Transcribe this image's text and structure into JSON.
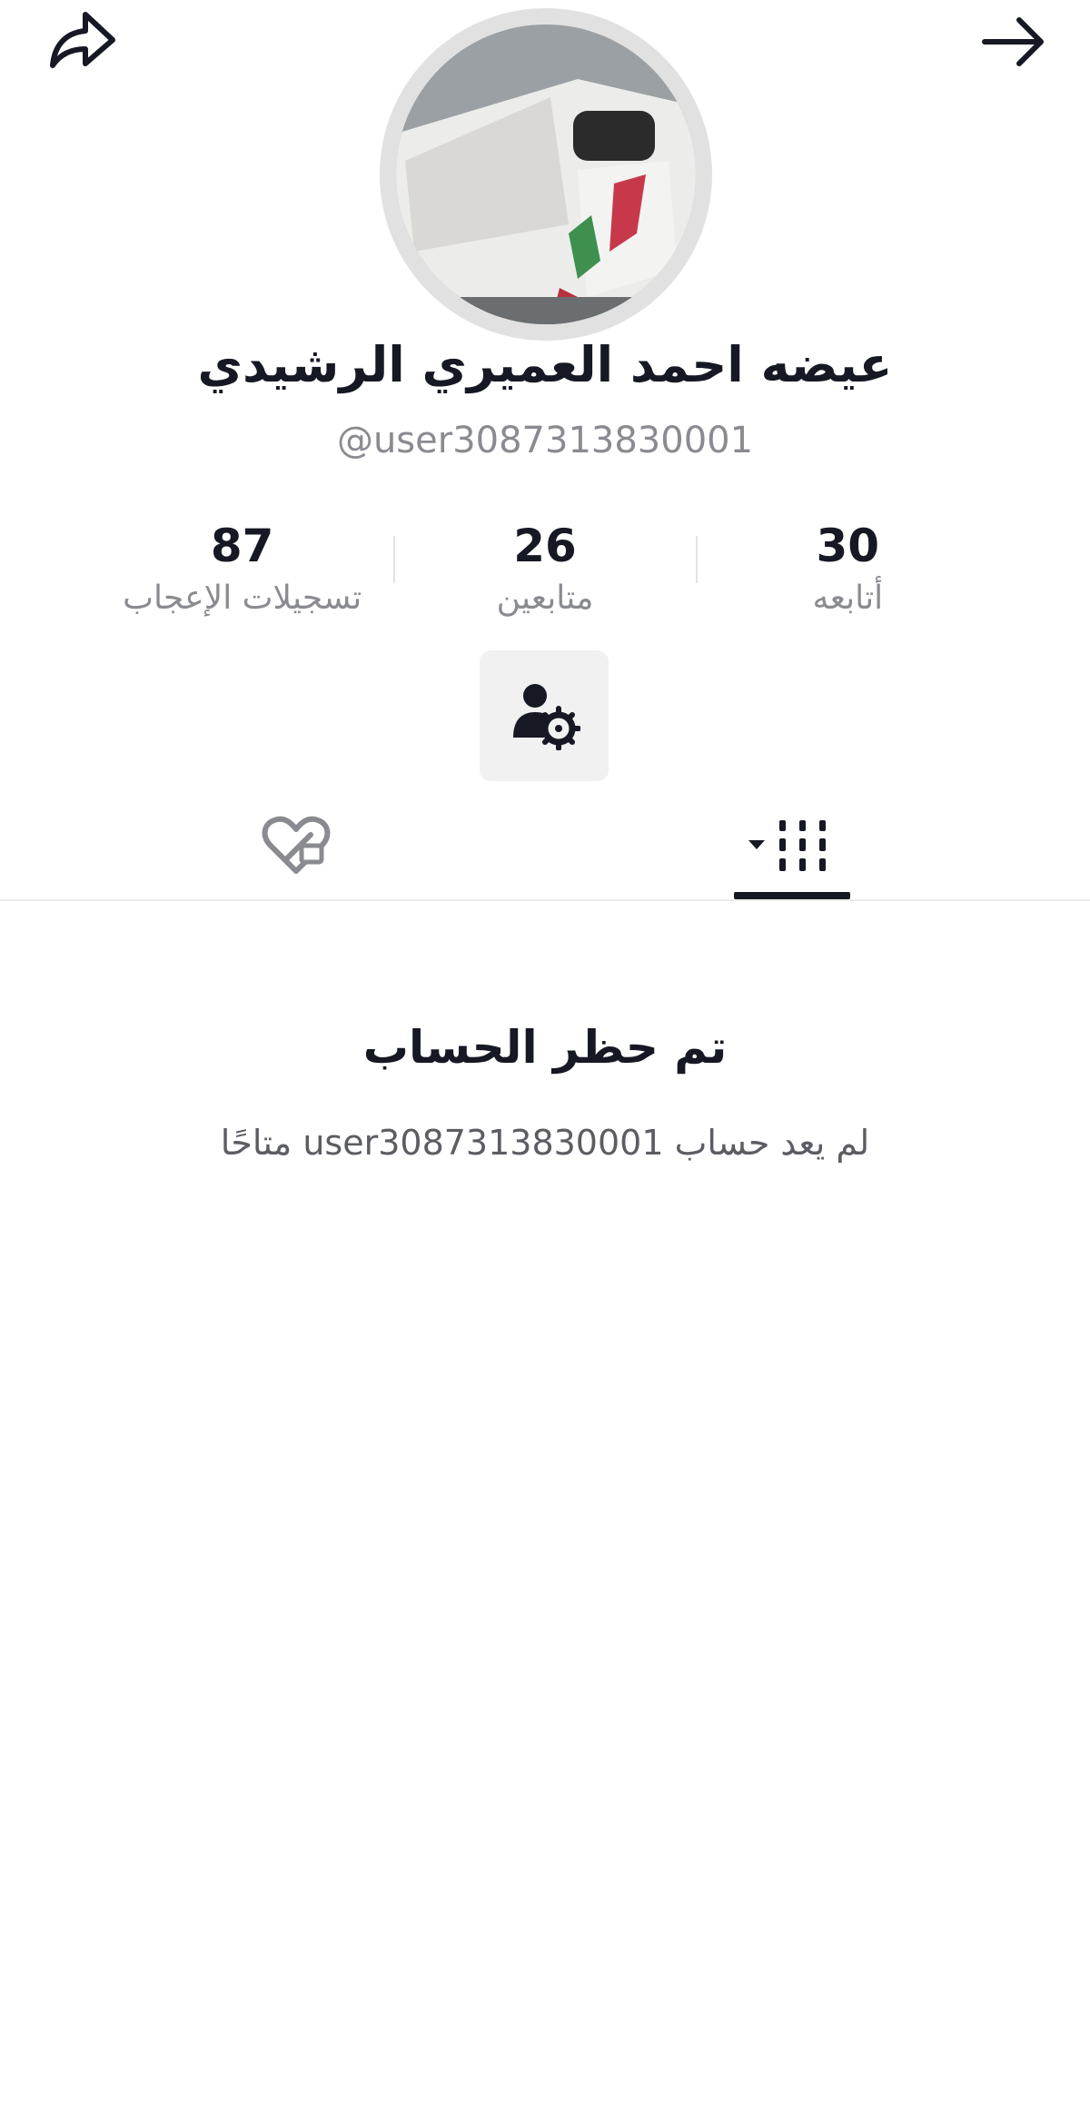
{
  "header": {
    "share_icon": "share-arrow-icon",
    "forward_icon": "arrow-right-icon"
  },
  "profile": {
    "display_name": "عيضه احمد العميري الرشيدي",
    "handle": "@user3087313830001",
    "avatar_description_icon": "avatar-photo"
  },
  "stats": [
    {
      "value": "87",
      "label": "تسجيلات الإعجاب"
    },
    {
      "value": "26",
      "label": "متابعين"
    },
    {
      "value": "30",
      "label": "أتابعه"
    }
  ],
  "manage_button": {
    "icon": "user-gear-icon"
  },
  "tabs": {
    "liked_icon": "heart-lock-icon",
    "videos_icon": "grid-dropdown-icon",
    "active": "videos"
  },
  "banned": {
    "title": "تم حظر الحساب",
    "description": "لم يعد حساب user3087313830001 متاحًا"
  },
  "colors": {
    "text_primary": "#161823",
    "text_secondary": "#8a8b91",
    "button_bg": "#f1f1f2",
    "avatar_ring": "#e1e1e1"
  }
}
